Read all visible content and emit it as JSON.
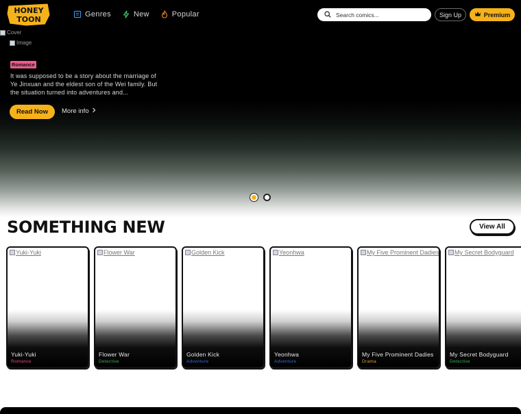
{
  "header": {
    "logo_text_top": "HONEY",
    "logo_text_bottom": "TOON",
    "nav": [
      {
        "label": "Genres",
        "icon": "book-icon"
      },
      {
        "label": "New",
        "icon": "bolt-icon"
      },
      {
        "label": "Popular",
        "icon": "flame-icon"
      }
    ],
    "search_placeholder": "Search comics...",
    "signup_label": "Sign Up",
    "premium_label": "Premium"
  },
  "hero": {
    "alt_images": [
      "Cover",
      "Image"
    ],
    "genre": "Romance",
    "description": "It was supposed to be a story about the marriage of Ye Jinxuan and the eldest son of the Wei family. But the situation turned into adventures and...",
    "read_now_label": "Read Now",
    "more_info_label": "More info",
    "slides_total": 2,
    "slide_active": 1
  },
  "section": {
    "title": "SOMETHING NEW",
    "view_all_label": "View All"
  },
  "comics": [
    {
      "title": "Yuki-Yuki",
      "alt": "Yuki-Yuki",
      "genre": "Romance",
      "genre_color": "#e0507a"
    },
    {
      "title": "Flower War",
      "alt": "Flower War",
      "genre": "Detective",
      "genre_color": "#3fae5a"
    },
    {
      "title": "Golden Kick",
      "alt": "Golden Kick",
      "genre": "Adventure",
      "genre_color": "#3b6fd1"
    },
    {
      "title": "Yeonhwa",
      "alt": "Yeonhwa",
      "genre": "Adventure",
      "genre_color": "#3b6fd1"
    },
    {
      "title": "My Five Prominent Dadies",
      "alt": "My Five Prominent Dadies",
      "genre": "Drama",
      "genre_color": "#e0a13a"
    },
    {
      "title": "My Secret Bodyguard",
      "alt": "My Secret Bodyguard",
      "genre": "Detective",
      "genre_color": "#3fae5a"
    }
  ],
  "colors": {
    "accent": "#f6b21b",
    "badge_romance": "#f05a8c"
  }
}
